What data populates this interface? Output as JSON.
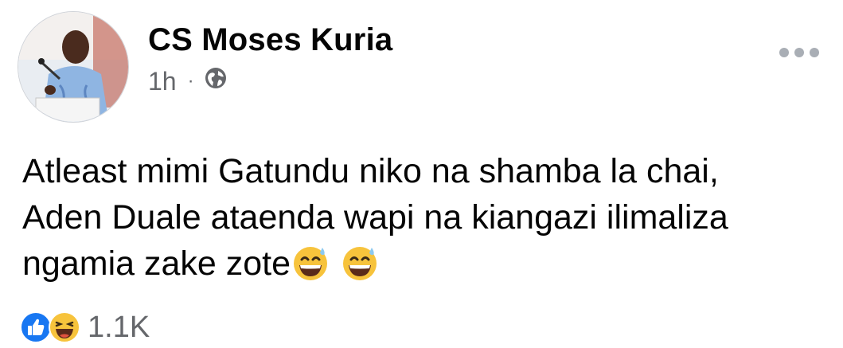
{
  "post": {
    "author": "CS Moses Kuria",
    "time": "1h",
    "separator": "·",
    "audience_icon": "globe-icon",
    "more_icon": "more-options-icon",
    "text_lines": [
      "Atleast mimi Gatundu niko na shamba la chai,",
      "Aden Duale ataenda wapi na kiangazi ilimaliza",
      "ngamia zake zote"
    ],
    "inline_emoji": [
      "grinning-sweat-emoji",
      "grinning-sweat-emoji"
    ]
  },
  "reactions": {
    "icons": [
      "like-reaction-icon",
      "haha-reaction-icon"
    ],
    "count": "1.1K"
  },
  "colors": {
    "text": "#050505",
    "secondary": "#65676b",
    "like_blue": "#1877f2",
    "emoji_yellow": "#f7c33c"
  }
}
